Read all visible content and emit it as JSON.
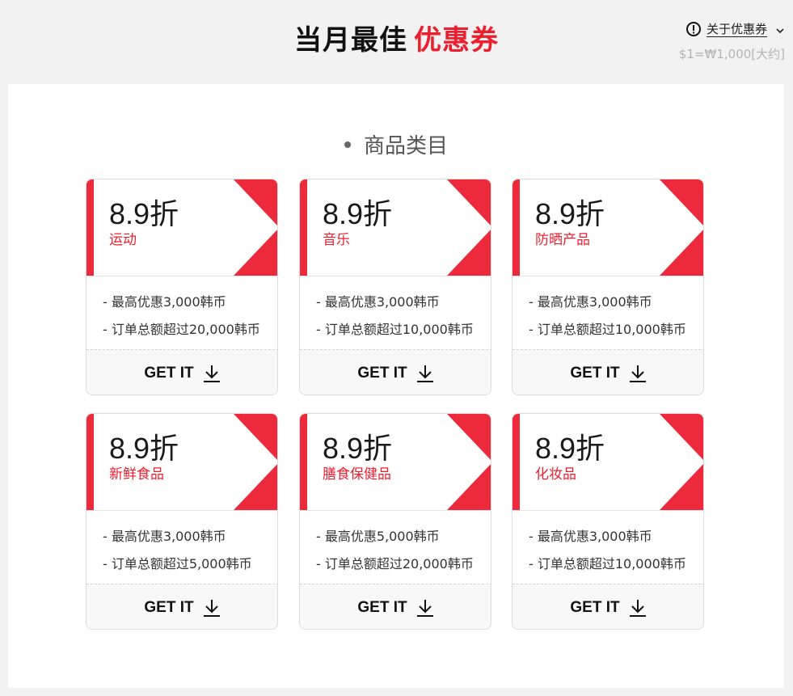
{
  "header": {
    "title": "当月最佳",
    "title_accent": "优惠券",
    "about_label": "关于优惠券",
    "exchange_rate": "$1=₩1,000[大约]"
  },
  "section": {
    "title": "商品类目"
  },
  "colors": {
    "accent": "#ec1f2f",
    "stripe": "#ec2a3b"
  },
  "get_label": "GET IT",
  "coupons": [
    {
      "discount": "8.9折",
      "category": "运动",
      "max_discount": "- 最高优惠3,000韩币",
      "min_order": "- 订单总额超过20,000韩币"
    },
    {
      "discount": "8.9折",
      "category": "音乐",
      "max_discount": "- 最高优惠3,000韩币",
      "min_order": "- 订单总额超过10,000韩币"
    },
    {
      "discount": "8.9折",
      "category": "防晒产品",
      "max_discount": "- 最高优惠3,000韩币",
      "min_order": "- 订单总额超过10,000韩币"
    },
    {
      "discount": "8.9折",
      "category": "新鲜食品",
      "max_discount": "- 最高优惠3,000韩币",
      "min_order": "- 订单总额超过5,000韩币"
    },
    {
      "discount": "8.9折",
      "category": "膳食保健品",
      "max_discount": "- 最高优惠5,000韩币",
      "min_order": "- 订单总额超过20,000韩币"
    },
    {
      "discount": "8.9折",
      "category": "化妆品",
      "max_discount": "- 最高优惠3,000韩币",
      "min_order": "- 订单总额超过10,000韩币"
    }
  ]
}
